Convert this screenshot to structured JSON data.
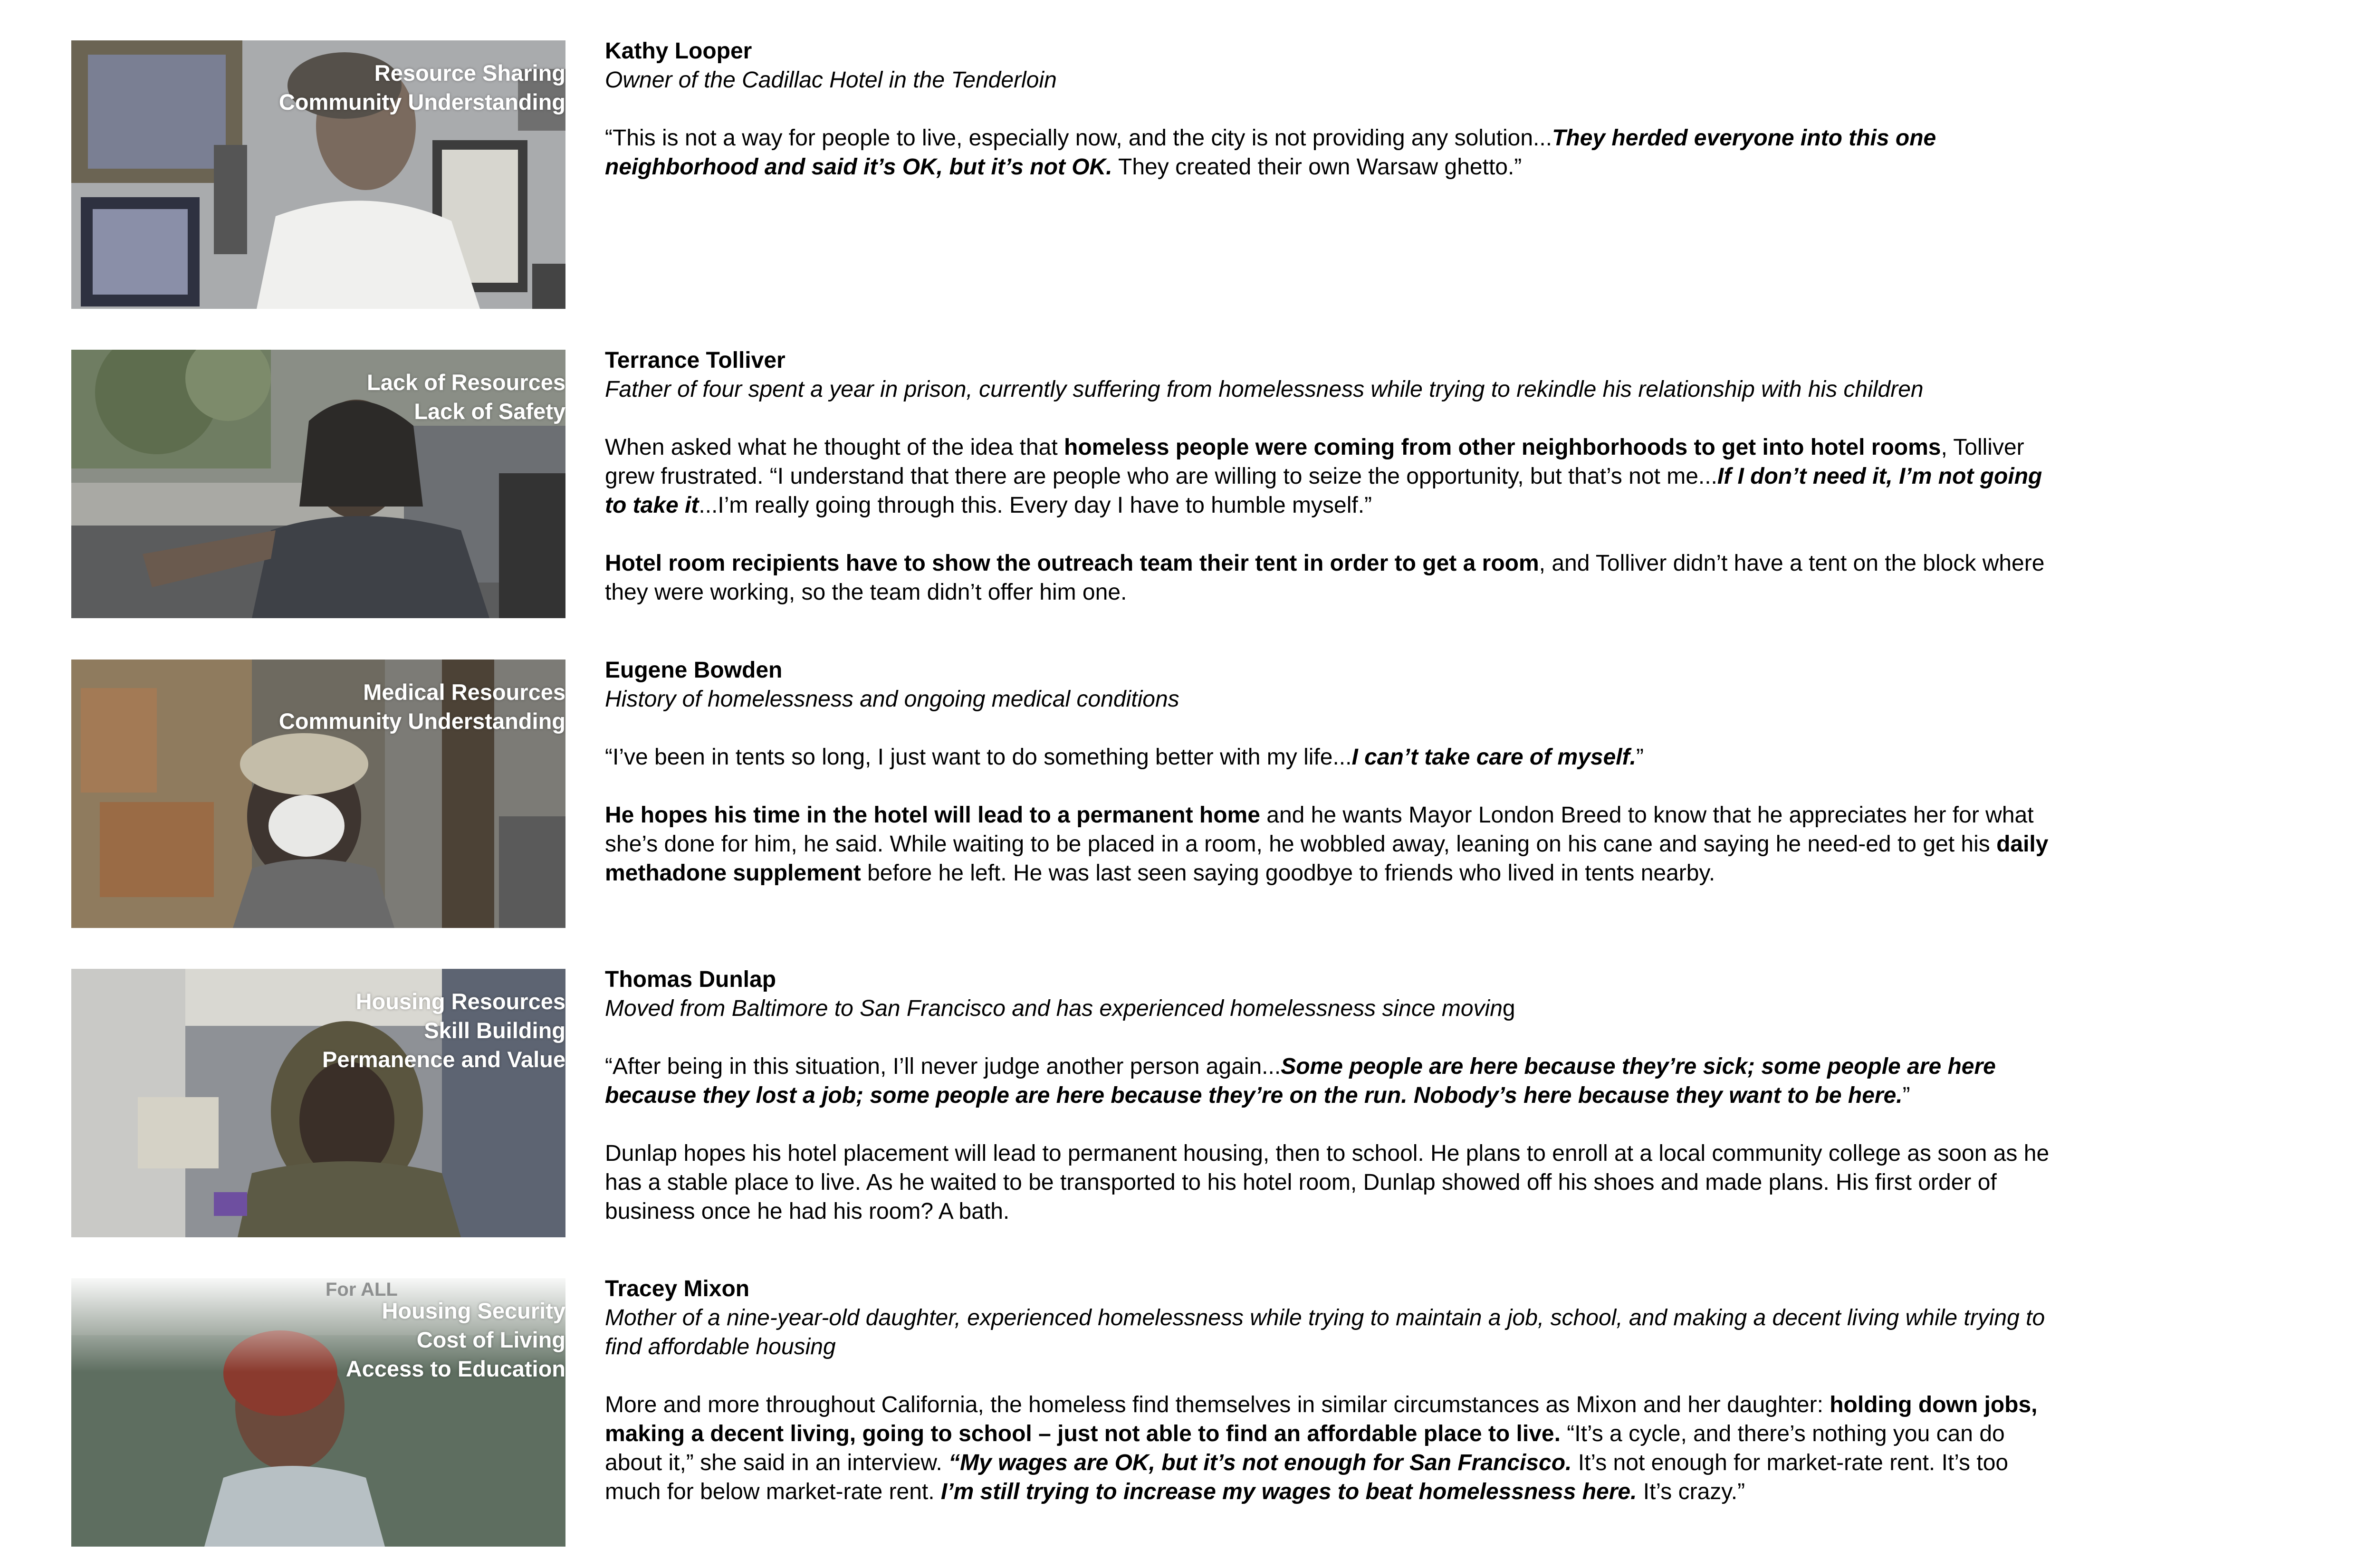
{
  "entries": [
    {
      "name": "Kathy Looper",
      "subtitle": "Owner of the Cadillac Hotel in the Tenderloin",
      "tags": [
        "Resource Sharing",
        "Community Understanding"
      ],
      "p1": [
        "“This is not a way for people to live, especially now, and the city is not providing any solution...",
        "They herded everyone into this one neighborhood and said it’s OK, but it’s not OK.",
        " They created their own Warsaw ghetto.”"
      ]
    },
    {
      "name": "Terrance Tolliver",
      "subtitle": "Father of four spent a year in prison, currently suffering from homelessness while trying to rekindle his relationship with his children",
      "tags": [
        "Lack of Resources",
        "Lack of Safety"
      ],
      "p1": [
        "When asked what he thought of the idea that ",
        "homeless people were coming from other neighborhoods to get into hotel rooms",
        ", Tolliver grew frustrated. “I understand that there are people who are willing to seize the opportunity, but that’s not me...",
        "If I don’t need it, I’m not going to take it",
        "...I’m really going through this. Every day I have to humble myself.”"
      ],
      "p2": [
        "Hotel room recipients have to show the outreach team their tent in order to get a room",
        ", and Tolliver didn’t have a tent on the block where they were working, so the team didn’t offer him one."
      ]
    },
    {
      "name": "Eugene Bowden",
      "subtitle": "History of homelessness and ongoing medical conditions",
      "tags": [
        "Medical Resources",
        "Community Understanding"
      ],
      "p1": [
        "“I’ve been in tents so long, I just want to do something better with my life...",
        "I can’t take care of myself.",
        "”"
      ],
      "p2": [
        "He hopes his time in the hotel will lead to a permanent home",
        " and he wants Mayor London Breed to know that he appreciates her for what she’s done for him, he said. While waiting to be placed in a room, he wobbled away, leaning on his cane and saying he need-ed to get his ",
        "daily methadone supplement",
        " before he left. He was last seen saying goodbye to friends who lived in tents nearby."
      ]
    },
    {
      "name": "Thomas Dunlap",
      "subtitle": "Moved from Baltimore to San Francisco and has experienced homelessness since movin",
      "subtitle_tail": "g",
      "tags": [
        "Housing Resources",
        "Skill Building",
        "Permanence and Value"
      ],
      "p1": [
        "“After being in this situation, I’ll never judge another person again...",
        "Some people are here because they’re sick; some people are here because they lost a job; some people are here because they’re on the run. Nobody’s here because they want to be here.",
        "”"
      ],
      "p2": "Dunlap hopes his hotel placement will lead to permanent housing, then to school. He plans to enroll at a local community college as soon as he has a stable place to live. As he waited to be transported to his hotel room, Dunlap showed off his shoes and made plans. His first order of business once he had his room? A bath."
    },
    {
      "name": "Tracey Mixon",
      "subtitle": "Mother of a nine-year-old daughter, experienced homelessness while trying to maintain a job, school, and making a decent living while trying to find affordable housing",
      "tags": [
        "Housing Security",
        "Cost of Living",
        "Access to Education"
      ],
      "photo_note": "For ALL",
      "p1": [
        "More and more throughout California, the homeless find themselves in similar circumstances as Mixon and her daughter: ",
        "holding down jobs, making a decent living, going to school – just not able to find an affordable place to live.",
        " “It’s a cycle, and there’s nothing you can do about it,” she said in an interview. ",
        "“My wages are OK, but it’s not enough for San Francisco.",
        " It’s not enough for market-rate rent. It’s too much for below market-rate rent. ",
        "I’m still trying to increase my wages to beat homelessness here.",
        " It’s crazy.”"
      ]
    }
  ]
}
